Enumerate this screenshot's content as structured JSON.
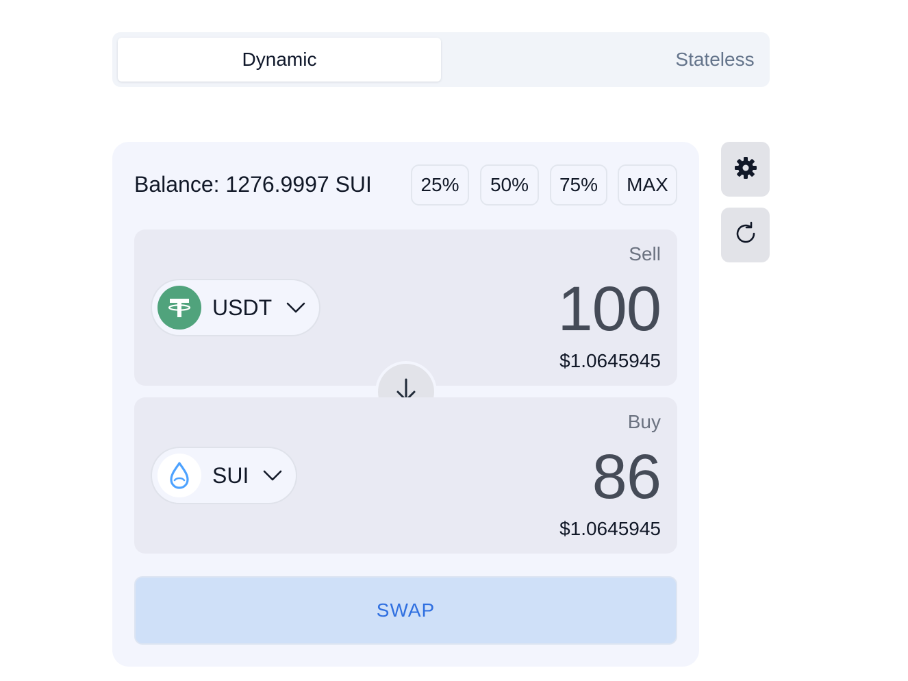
{
  "mode_tabs": [
    {
      "label": "Dynamic",
      "active": true
    },
    {
      "label": "Stateless",
      "active": false
    }
  ],
  "balance": {
    "text": "Balance: 1276.9997 SUI"
  },
  "percent_buttons": [
    "25%",
    "50%",
    "75%",
    "MAX"
  ],
  "sell": {
    "label": "Sell",
    "token": "USDT",
    "amount": "100",
    "usd_value": "$1.0645945"
  },
  "buy": {
    "label": "Buy",
    "token": "SUI",
    "amount": "86",
    "usd_value": "$1.0645945"
  },
  "swap_button": {
    "label": "SWAP"
  },
  "icons": {
    "settings": "gear-icon",
    "refresh": "refresh-icon",
    "flip": "arrow-down-icon",
    "chevron": "chevron-down-icon",
    "usdt": "tether-logo",
    "sui": "sui-droplet-logo"
  },
  "colors": {
    "accent": "#2f6fe0",
    "swap_bg": "#cfe0f8",
    "usdt_green": "#50a37c",
    "sui_blue": "#4da2ff"
  }
}
